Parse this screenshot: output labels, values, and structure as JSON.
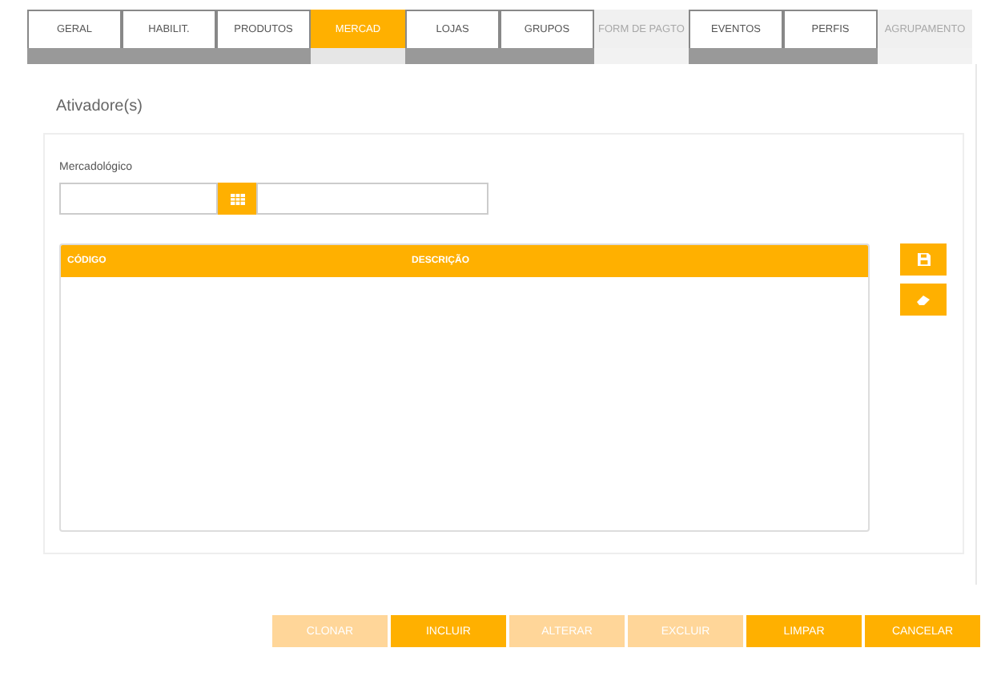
{
  "tabs": [
    {
      "label": "GERAL",
      "selected": false,
      "disabled": false
    },
    {
      "label": "HABILIT.",
      "selected": false,
      "disabled": false
    },
    {
      "label": "PRODUTOS",
      "selected": false,
      "disabled": false
    },
    {
      "label": "MERCAD",
      "selected": true,
      "disabled": false
    },
    {
      "label": "LOJAS",
      "selected": false,
      "disabled": false
    },
    {
      "label": "GRUPOS",
      "selected": false,
      "disabled": false
    },
    {
      "label": "FORM DE PAGTO",
      "selected": false,
      "disabled": true
    },
    {
      "label": "EVENTOS",
      "selected": false,
      "disabled": false
    },
    {
      "label": "PERFIS",
      "selected": false,
      "disabled": false
    },
    {
      "label": "AGRUPAMENTO",
      "selected": false,
      "disabled": true
    }
  ],
  "section_title": "Ativadore(s)",
  "field": {
    "label": "Mercadológico"
  },
  "table": {
    "columns": [
      "CÓDIGO",
      "DESCRIÇÃO"
    ]
  },
  "side_buttons": [
    {
      "kind": "save"
    },
    {
      "kind": "eraser"
    }
  ],
  "buttons": [
    {
      "label": "CLONAR",
      "disabled": true
    },
    {
      "label": "INCLUIR",
      "disabled": false
    },
    {
      "label": "ALTERAR",
      "disabled": true
    },
    {
      "label": "EXCLUIR",
      "disabled": true
    },
    {
      "label": "LIMPAR",
      "disabled": false
    },
    {
      "label": "CANCELAR",
      "disabled": false
    }
  ]
}
